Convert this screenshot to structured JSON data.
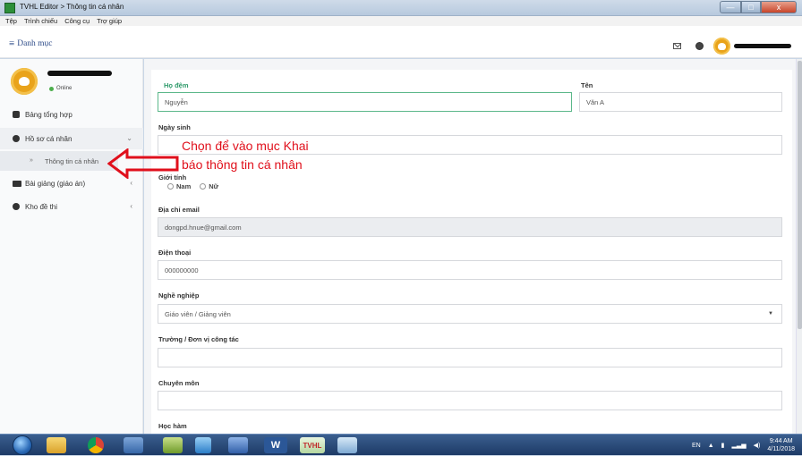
{
  "window": {
    "title": "TVHL Editor > Thông tin cá nhân",
    "buttons": {
      "minimize": "—",
      "maximize": "□",
      "close": "x"
    }
  },
  "menubar": [
    "Tệp",
    "Trình chiếu",
    "Công cụ",
    "Trợ giúp"
  ],
  "header": {
    "menu_label": "Danh mục",
    "menu_icon": "hamburger-icon",
    "icons": [
      "mail-icon",
      "globe-icon"
    ]
  },
  "sidebar": {
    "status": "Online",
    "items": [
      {
        "label": "Bảng tổng hợp",
        "icon": "dashboard-icon"
      },
      {
        "label": "Hồ sơ cá nhân",
        "icon": "user-circle-icon",
        "chevron": "⌄"
      },
      {
        "label": "Thông tin cá nhân",
        "arrow": "»"
      },
      {
        "label": "Bài giảng (giáo án)",
        "icon": "slides-icon",
        "chevron": "‹"
      },
      {
        "label": "Kho đề thi",
        "icon": "question-icon",
        "chevron": "‹"
      }
    ]
  },
  "form": {
    "ho_dem": {
      "label": "Họ đệm",
      "value": "Nguyễn"
    },
    "ten": {
      "label": "Tên",
      "value": "Văn A"
    },
    "ngay_sinh": {
      "label": "Ngày sinh",
      "value": ""
    },
    "gioi_tinh": {
      "label": "Giới tính",
      "options": [
        "Nam",
        "Nữ"
      ]
    },
    "email": {
      "label": "Địa chỉ email",
      "value": "dongpd.hnue@gmail.com"
    },
    "dien_thoai": {
      "label": "Điện thoại",
      "value": "000000000"
    },
    "nghe_nghiep": {
      "label": "Nghề nghiệp",
      "value": "Giáo viên / Giảng viên"
    },
    "truong": {
      "label": "Trường / Đơn vị công tác",
      "value": ""
    },
    "chuyen_mon": {
      "label": "Chuyên môn",
      "value": ""
    },
    "hoc_ham": {
      "label": "Học hàm"
    }
  },
  "annotation": {
    "line1": "Chọn để vào mục Khai",
    "line2": "báo thông tin cá nhân",
    "color": "#e0101c"
  },
  "taskbar": {
    "lang": "EN",
    "time": "9:44 AM",
    "date": "4/11/2018",
    "word_label": "W",
    "tvhl_label": "TVHL"
  }
}
